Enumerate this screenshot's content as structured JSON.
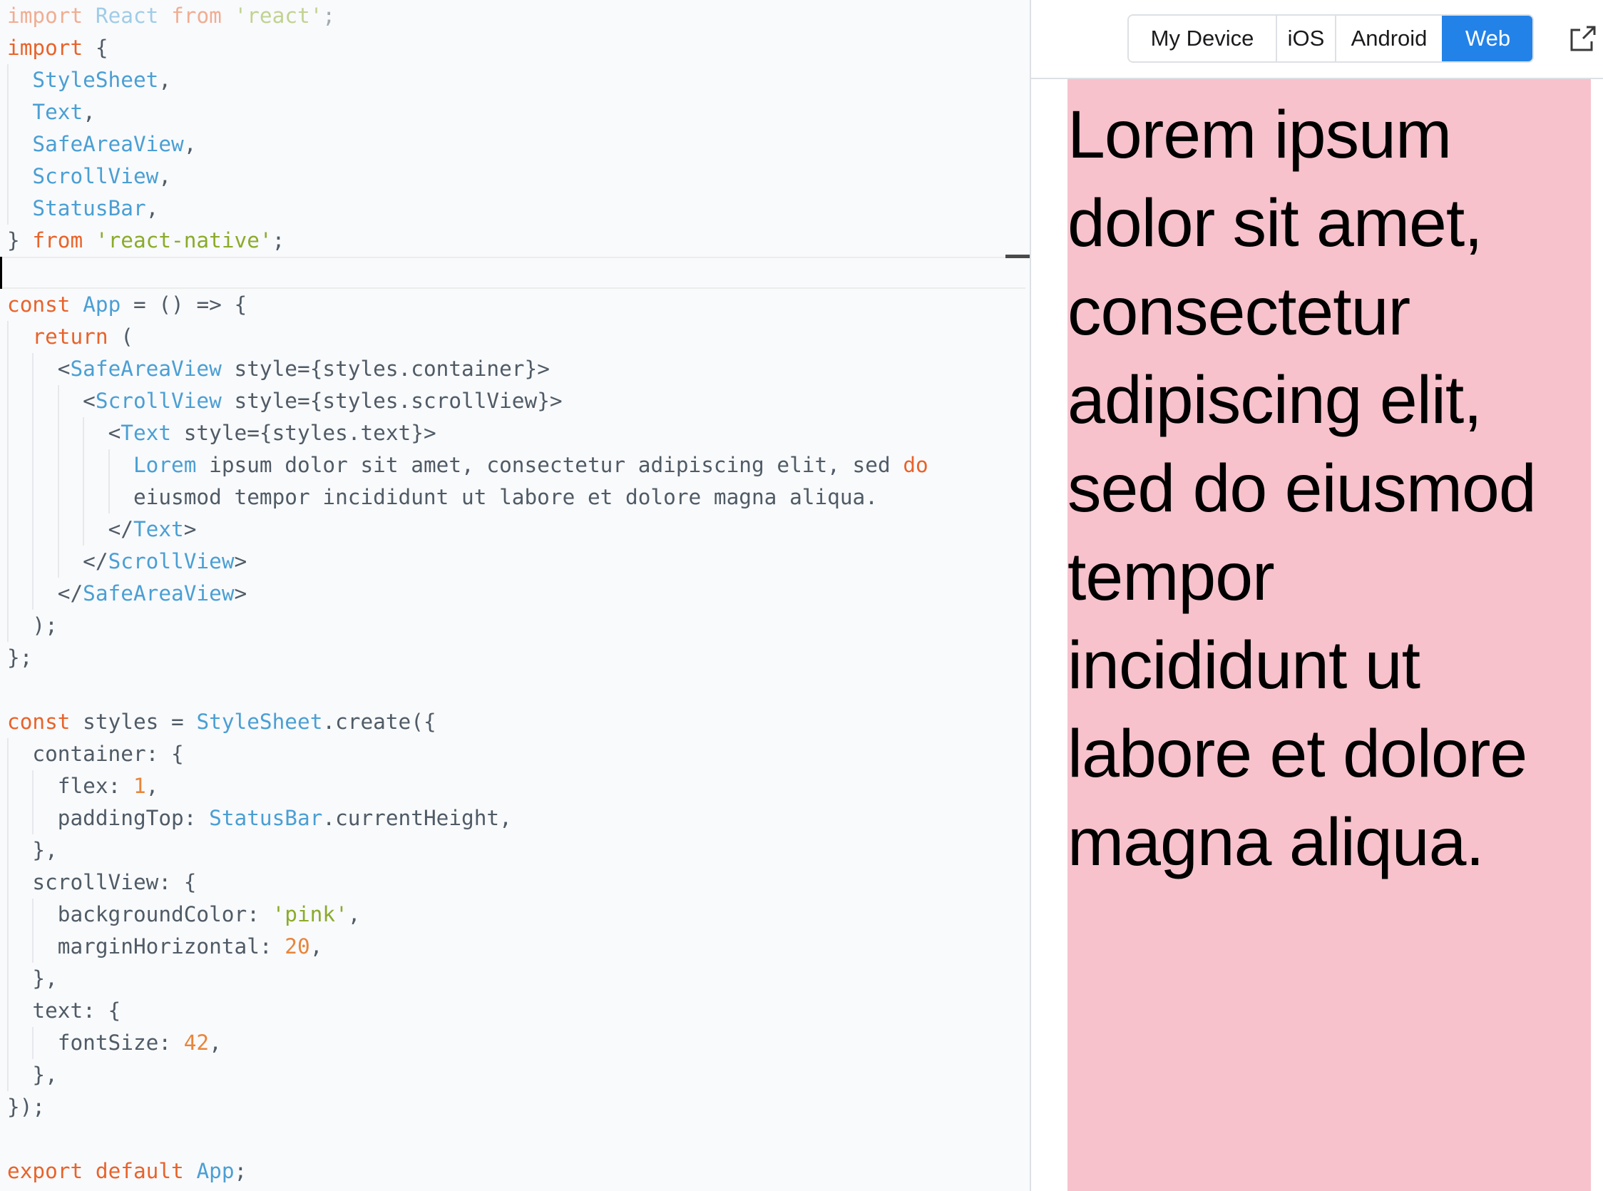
{
  "editor": {
    "active_line_index": 8,
    "lines": [
      {
        "indent": 0,
        "dim": true,
        "tokens": [
          [
            "kw",
            "import"
          ],
          [
            "plain",
            " "
          ],
          [
            "id",
            "React"
          ],
          [
            "plain",
            " "
          ],
          [
            "kw",
            "from"
          ],
          [
            "plain",
            " "
          ],
          [
            "str",
            "'react'"
          ],
          [
            "plain",
            ";"
          ]
        ]
      },
      {
        "indent": 0,
        "tokens": [
          [
            "kw",
            "import"
          ],
          [
            "plain",
            " {"
          ]
        ]
      },
      {
        "indent": 1,
        "tokens": [
          [
            "id",
            "StyleSheet"
          ],
          [
            "plain",
            ","
          ]
        ]
      },
      {
        "indent": 1,
        "tokens": [
          [
            "id",
            "Text"
          ],
          [
            "plain",
            ","
          ]
        ]
      },
      {
        "indent": 1,
        "tokens": [
          [
            "id",
            "SafeAreaView"
          ],
          [
            "plain",
            ","
          ]
        ]
      },
      {
        "indent": 1,
        "tokens": [
          [
            "id",
            "ScrollView"
          ],
          [
            "plain",
            ","
          ]
        ]
      },
      {
        "indent": 1,
        "tokens": [
          [
            "id",
            "StatusBar"
          ],
          [
            "plain",
            ","
          ]
        ]
      },
      {
        "indent": 0,
        "tokens": [
          [
            "plain",
            "} "
          ],
          [
            "kw",
            "from"
          ],
          [
            "plain",
            " "
          ],
          [
            "str",
            "'react-native'"
          ],
          [
            "plain",
            ";"
          ]
        ]
      },
      {
        "indent": 0,
        "tokens": []
      },
      {
        "indent": 0,
        "tokens": [
          [
            "kw",
            "const"
          ],
          [
            "plain",
            " "
          ],
          [
            "id",
            "App"
          ],
          [
            "plain",
            " = () => {"
          ]
        ]
      },
      {
        "indent": 1,
        "tokens": [
          [
            "kw",
            "return"
          ],
          [
            "plain",
            " ("
          ]
        ]
      },
      {
        "indent": 2,
        "tokens": [
          [
            "plain",
            "<"
          ],
          [
            "id",
            "SafeAreaView"
          ],
          [
            "plain",
            " style={styles.container}>"
          ]
        ]
      },
      {
        "indent": 3,
        "tokens": [
          [
            "plain",
            "<"
          ],
          [
            "id",
            "ScrollView"
          ],
          [
            "plain",
            " style={styles.scrollView}>"
          ]
        ]
      },
      {
        "indent": 4,
        "tokens": [
          [
            "plain",
            "<"
          ],
          [
            "id",
            "Text"
          ],
          [
            "plain",
            " style={styles.text}>"
          ]
        ]
      },
      {
        "indent": 5,
        "tokens": [
          [
            "id",
            "Lorem"
          ],
          [
            "plain",
            " ipsum dolor sit amet, consectetur adipiscing elit, sed "
          ],
          [
            "kw",
            "do"
          ]
        ]
      },
      {
        "indent": 5,
        "tokens": [
          [
            "plain",
            "eiusmod tempor incididunt ut labore et dolore magna aliqua."
          ]
        ]
      },
      {
        "indent": 4,
        "tokens": [
          [
            "plain",
            "</"
          ],
          [
            "id",
            "Text"
          ],
          [
            "plain",
            ">"
          ]
        ]
      },
      {
        "indent": 3,
        "tokens": [
          [
            "plain",
            "</"
          ],
          [
            "id",
            "ScrollView"
          ],
          [
            "plain",
            ">"
          ]
        ]
      },
      {
        "indent": 2,
        "tokens": [
          [
            "plain",
            "</"
          ],
          [
            "id",
            "SafeAreaView"
          ],
          [
            "plain",
            ">"
          ]
        ]
      },
      {
        "indent": 1,
        "tokens": [
          [
            "plain",
            ");"
          ]
        ]
      },
      {
        "indent": 0,
        "tokens": [
          [
            "plain",
            "};"
          ]
        ]
      },
      {
        "indent": 0,
        "tokens": []
      },
      {
        "indent": 0,
        "tokens": [
          [
            "kw",
            "const"
          ],
          [
            "plain",
            " styles = "
          ],
          [
            "id",
            "StyleSheet"
          ],
          [
            "plain",
            ".create({"
          ]
        ]
      },
      {
        "indent": 1,
        "tokens": [
          [
            "plain",
            "container: {"
          ]
        ]
      },
      {
        "indent": 2,
        "tokens": [
          [
            "plain",
            "flex: "
          ],
          [
            "num",
            "1"
          ],
          [
            "plain",
            ","
          ]
        ]
      },
      {
        "indent": 2,
        "tokens": [
          [
            "plain",
            "paddingTop: "
          ],
          [
            "id",
            "StatusBar"
          ],
          [
            "plain",
            ".currentHeight,"
          ]
        ]
      },
      {
        "indent": 1,
        "tokens": [
          [
            "plain",
            "},"
          ]
        ]
      },
      {
        "indent": 1,
        "tokens": [
          [
            "plain",
            "scrollView: {"
          ]
        ]
      },
      {
        "indent": 2,
        "tokens": [
          [
            "plain",
            "backgroundColor: "
          ],
          [
            "str",
            "'pink'"
          ],
          [
            "plain",
            ","
          ]
        ]
      },
      {
        "indent": 2,
        "tokens": [
          [
            "plain",
            "marginHorizontal: "
          ],
          [
            "num",
            "20"
          ],
          [
            "plain",
            ","
          ]
        ]
      },
      {
        "indent": 1,
        "tokens": [
          [
            "plain",
            "},"
          ]
        ]
      },
      {
        "indent": 1,
        "tokens": [
          [
            "plain",
            "text: {"
          ]
        ]
      },
      {
        "indent": 2,
        "tokens": [
          [
            "plain",
            "fontSize: "
          ],
          [
            "num",
            "42"
          ],
          [
            "plain",
            ","
          ]
        ]
      },
      {
        "indent": 1,
        "tokens": [
          [
            "plain",
            "},"
          ]
        ]
      },
      {
        "indent": 0,
        "tokens": [
          [
            "plain",
            "});"
          ]
        ]
      },
      {
        "indent": 0,
        "tokens": []
      },
      {
        "indent": 0,
        "tokens": [
          [
            "kw",
            "export"
          ],
          [
            "plain",
            " "
          ],
          [
            "kw",
            "default"
          ],
          [
            "plain",
            " "
          ],
          [
            "id",
            "App"
          ],
          [
            "plain",
            ";"
          ]
        ]
      }
    ],
    "guides": [
      {
        "from": 2,
        "to": 6,
        "level": 0
      },
      {
        "from": 10,
        "to": 19,
        "level": 0
      },
      {
        "from": 11,
        "to": 18,
        "level": 1
      },
      {
        "from": 12,
        "to": 17,
        "level": 2
      },
      {
        "from": 13,
        "to": 16,
        "level": 3
      },
      {
        "from": 14,
        "to": 15,
        "level": 4
      },
      {
        "from": 23,
        "to": 33,
        "level": 0
      },
      {
        "from": 24,
        "to": 25,
        "level": 1
      },
      {
        "from": 28,
        "to": 29,
        "level": 1
      },
      {
        "from": 32,
        "to": 32,
        "level": 1
      }
    ]
  },
  "preview": {
    "platform_tabs": [
      {
        "label": "My Device",
        "active": false
      },
      {
        "label": "iOS",
        "active": false
      },
      {
        "label": "Android",
        "active": false
      },
      {
        "label": "Web",
        "active": true
      }
    ],
    "open_icon": "external-link-icon",
    "scroll_view_background": "#f7c2cc",
    "accent_color": "#2382e8",
    "rendered_text_lines": [
      "Lorem ipsum",
      "dolor sit amet,",
      "consectetur",
      "adipiscing elit,",
      "sed do eiusmod",
      "tempor",
      "incididunt ut",
      "labore et dolore",
      "magna aliqua."
    ]
  }
}
